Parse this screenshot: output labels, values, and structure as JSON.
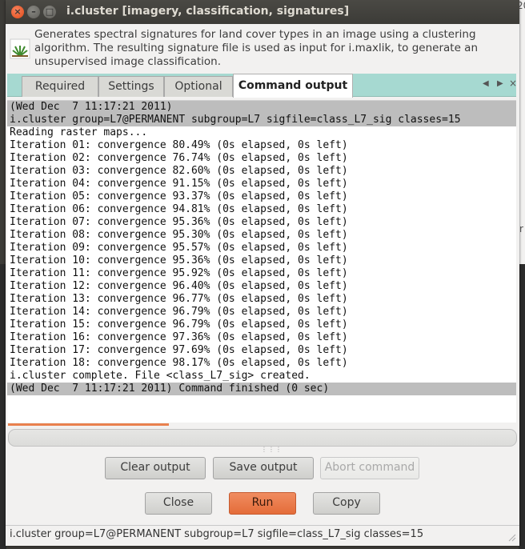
{
  "window": {
    "title": "i.cluster [imagery, classification, signatures]",
    "close_glyph": "×",
    "min_glyph": "–",
    "max_glyph": "□"
  },
  "description": "Generates spectral signatures for land cover types in an image using a clustering algorithm. The resulting signature file is used as input for i.maxlik, to generate an unsupervised image classification.",
  "tabs": [
    {
      "label": "Required"
    },
    {
      "label": "Settings"
    },
    {
      "label": "Optional"
    },
    {
      "label": "Command output"
    }
  ],
  "tab_nav": {
    "prev": "◀",
    "next": "▶",
    "close": "×"
  },
  "output": {
    "lines": [
      {
        "text": "(Wed Dec  7 11:17:21 2011)",
        "highlight": true
      },
      {
        "text": "i.cluster group=L7@PERMANENT subgroup=L7 sigfile=class_L7_sig classes=15",
        "highlight": true
      },
      {
        "text": "Reading raster maps...",
        "highlight": false
      },
      {
        "text": "Iteration 01: convergence 80.49% (0s elapsed, 0s left)",
        "highlight": false
      },
      {
        "text": "Iteration 02: convergence 76.74% (0s elapsed, 0s left)",
        "highlight": false
      },
      {
        "text": "Iteration 03: convergence 82.60% (0s elapsed, 0s left)",
        "highlight": false
      },
      {
        "text": "Iteration 04: convergence 91.15% (0s elapsed, 0s left)",
        "highlight": false
      },
      {
        "text": "Iteration 05: convergence 93.37% (0s elapsed, 0s left)",
        "highlight": false
      },
      {
        "text": "Iteration 06: convergence 94.81% (0s elapsed, 0s left)",
        "highlight": false
      },
      {
        "text": "Iteration 07: convergence 95.36% (0s elapsed, 0s left)",
        "highlight": false
      },
      {
        "text": "Iteration 08: convergence 95.30% (0s elapsed, 0s left)",
        "highlight": false
      },
      {
        "text": "Iteration 09: convergence 95.57% (0s elapsed, 0s left)",
        "highlight": false
      },
      {
        "text": "Iteration 10: convergence 95.36% (0s elapsed, 0s left)",
        "highlight": false
      },
      {
        "text": "Iteration 11: convergence 95.92% (0s elapsed, 0s left)",
        "highlight": false
      },
      {
        "text": "Iteration 12: convergence 96.40% (0s elapsed, 0s left)",
        "highlight": false
      },
      {
        "text": "Iteration 13: convergence 96.77% (0s elapsed, 0s left)",
        "highlight": false
      },
      {
        "text": "Iteration 14: convergence 96.79% (0s elapsed, 0s left)",
        "highlight": false
      },
      {
        "text": "Iteration 15: convergence 96.79% (0s elapsed, 0s left)",
        "highlight": false
      },
      {
        "text": "Iteration 16: convergence 97.36% (0s elapsed, 0s left)",
        "highlight": false
      },
      {
        "text": "Iteration 17: convergence 97.69% (0s elapsed, 0s left)",
        "highlight": false
      },
      {
        "text": "Iteration 18: convergence 98.17% (0s elapsed, 0s left)",
        "highlight": false
      },
      {
        "text": "i.cluster complete. File <class_L7_sig> created.",
        "highlight": false
      },
      {
        "text": "(Wed Dec  7 11:17:21 2011) Command finished (0 sec)",
        "highlight": true
      }
    ]
  },
  "progress": {
    "value_percent": 0
  },
  "buttons": {
    "clear_output": "Clear output",
    "save_output": "Save output",
    "abort_command": "Abort command",
    "close": "Close",
    "run": "Run",
    "copy": "Copy"
  },
  "statusbar": {
    "text": "i.cluster group=L7@PERMANENT subgroup=L7 sigfile=class_L7_sig classes=15"
  },
  "background_fragments": {
    "right_top": "20",
    "right_mid": "r"
  },
  "colors": {
    "run_button": "#e46c39",
    "tab_strip": "#a6d9d1",
    "highlight_line": "#bdbdbd",
    "progress_accent": "#e9814e"
  }
}
